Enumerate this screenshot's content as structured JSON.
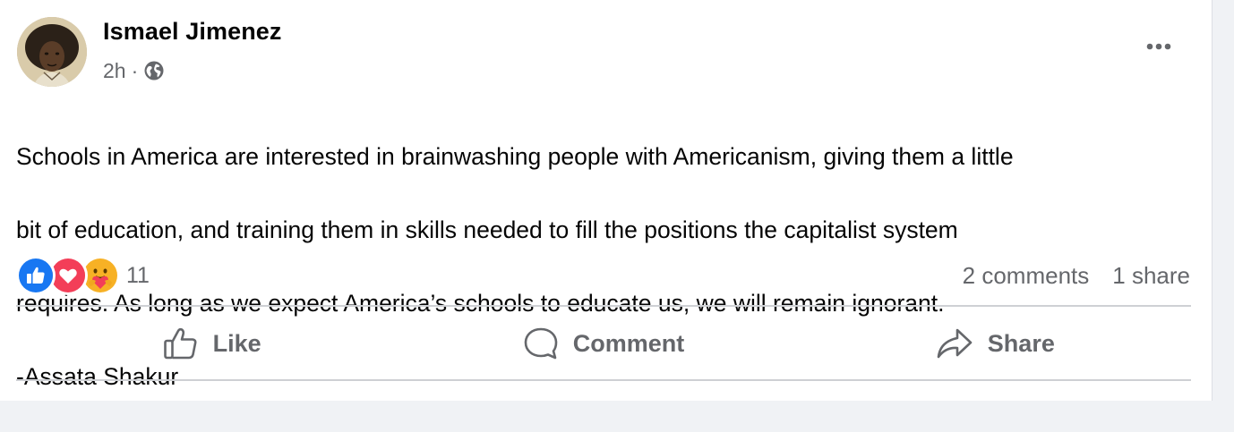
{
  "post": {
    "author": "Ismael Jimenez",
    "time": "2h",
    "separator": "·",
    "audience_icon": "globe-icon",
    "more_icon": "more-options-icon",
    "text_lines": [
      "Schools in America are interested in brainwashing people with Americanism, giving them a little",
      "bit of education, and training them in skills needed to fill the positions the capitalist system",
      "requires. As long as we expect America’s schools to educate us, we will remain ignorant.",
      "-Assata Shakur"
    ]
  },
  "reactions": {
    "icons": [
      "like-reaction-icon",
      "love-reaction-icon",
      "care-reaction-icon"
    ],
    "count": "11"
  },
  "stats": {
    "comments": "2 comments",
    "shares": "1 share"
  },
  "actions": {
    "like_label": "Like",
    "comment_label": "Comment",
    "share_label": "Share"
  },
  "colors": {
    "like_blue": "#1877f2",
    "love_red": "#f33e58",
    "care_yellow": "#f7b125",
    "secondary_text": "#65676b"
  }
}
